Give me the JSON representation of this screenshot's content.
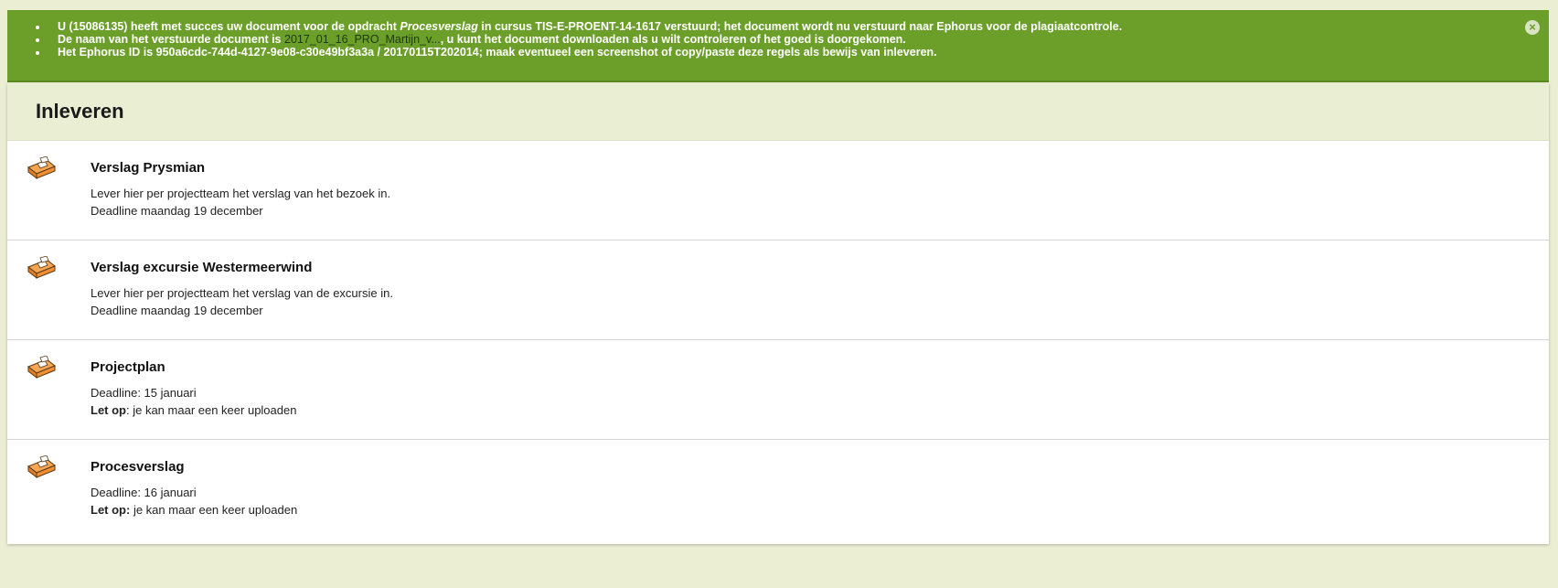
{
  "alert": {
    "messages": {
      "line1": {
        "prefix": "U (15086135) heeft met succes uw document voor de opdracht ",
        "assignment": "Procesverslag",
        "suffix": " in cursus TIS-E-PROENT-14-1617 verstuurd; het document wordt nu verstuurd naar Ephorus voor de plagiaatcontrole."
      },
      "line2": {
        "prefix": "De naam van het verstuurde document is ",
        "doc_link": "2017_01_16_PRO_Martijn_v...",
        "suffix": ", u kunt het document downloaden als u wilt controleren of het goed is doorgekomen."
      },
      "line3": {
        "text": "Het Ephorus ID is 950a6cdc-744d-4127-9e08-c30e49bf3a3a / 20170115T202014; maak eventueel een screenshot of copy/paste deze regels als bewijs van inleveren."
      }
    },
    "close_icon": "×"
  },
  "panel": {
    "title": "Inleveren",
    "items": [
      {
        "title": "Verslag Prysmian",
        "line1": "Lever hier per projectteam het verslag van het bezoek in.",
        "line2": "Deadline maandag 19 december"
      },
      {
        "title": "Verslag excursie Westermeerwind",
        "line1": "Lever hier per projectteam het verslag van de excursie in.",
        "line2": "Deadline maandag 19 december"
      },
      {
        "title": "Projectplan",
        "line1": "Deadline: 15 januari",
        "line2_bold": "Let op",
        "line2_rest": ": je kan maar een keer uploaden"
      },
      {
        "title": "Procesverslag",
        "line1": "Deadline: 16 januari",
        "line2_bold": "Let op:",
        "line2_rest": " je kan maar een keer uploaden"
      }
    ]
  },
  "icons": {
    "item_icon": "dropbox-tray-icon",
    "close_icon": "close-icon"
  },
  "colors": {
    "alert_bg": "#6c9f2a",
    "page_bg": "#ebeed3",
    "icon_orange": "#f0913a"
  }
}
